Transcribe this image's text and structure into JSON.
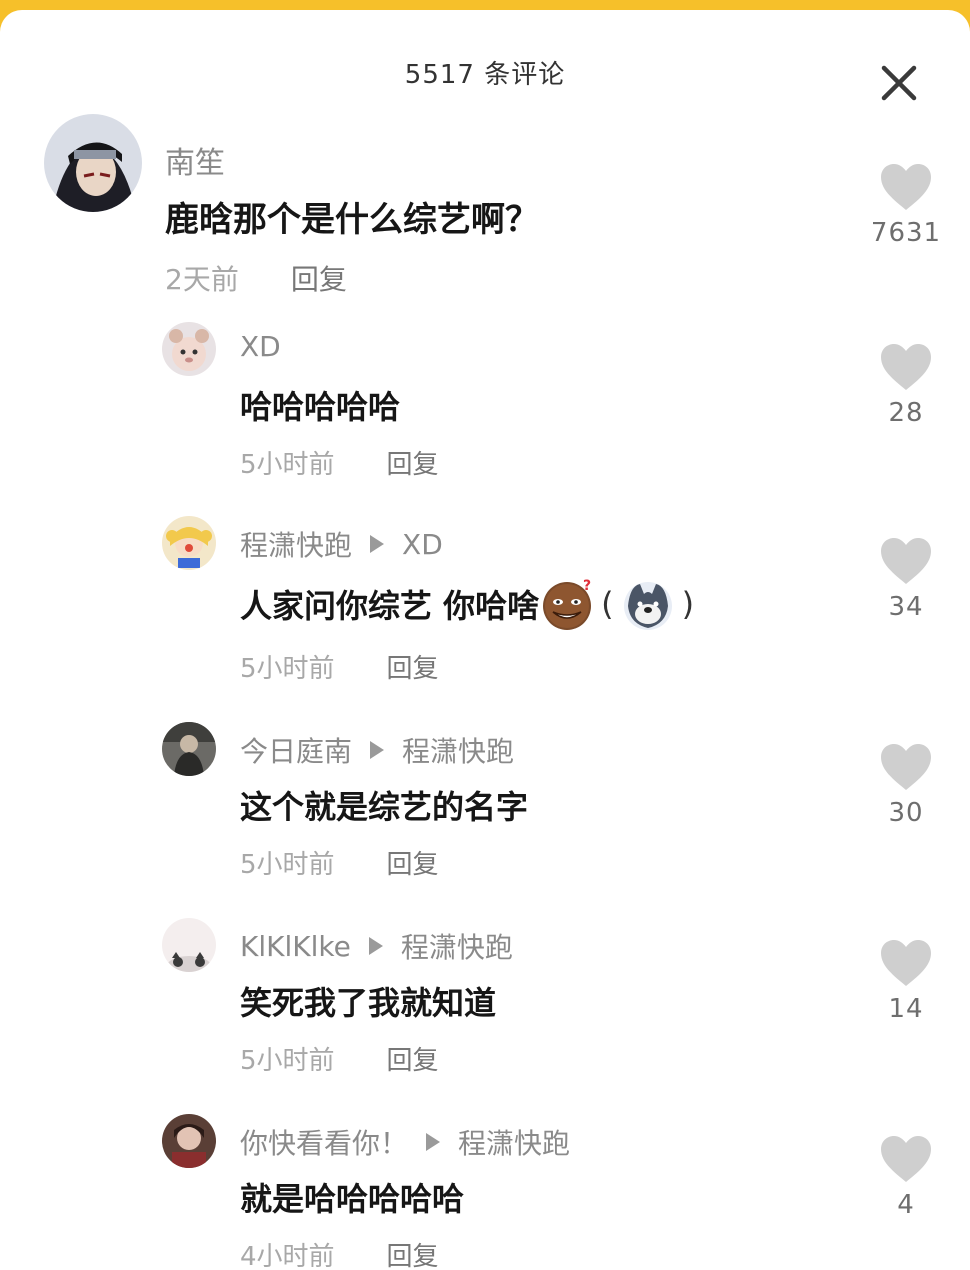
{
  "header": {
    "title": "5517 条评论"
  },
  "icons": {
    "close": "close-icon",
    "like": "heart-icon"
  },
  "colors": {
    "top_bar": "#f6c02a",
    "like_heart": "#cfcfcf"
  },
  "comments": [
    {
      "user": "南笙",
      "text": "鹿晗那个是什么综艺啊？",
      "time": "2天前",
      "reply_label": "回复",
      "likes": "7631"
    }
  ],
  "replies": [
    {
      "user": "XD",
      "reply_to": "",
      "text": "哈哈哈哈哈",
      "time": "5小时前",
      "reply_label": "回复",
      "likes": "28"
    },
    {
      "user": "程潇快跑",
      "reply_to": "XD",
      "text": "人家问你综艺  你哈啥",
      "paren_open": "(",
      "paren_close": ")",
      "time": "5小时前",
      "reply_label": "回复",
      "likes": "34"
    },
    {
      "user": "今日庭南",
      "reply_to": "程潇快跑",
      "text": "这个就是综艺的名字",
      "time": "5小时前",
      "reply_label": "回复",
      "likes": "30"
    },
    {
      "user": "KlKlKlke",
      "reply_to": "程潇快跑",
      "text": "笑死我了我就知道",
      "time": "5小时前",
      "reply_label": "回复",
      "likes": "14"
    },
    {
      "user": "你快看看你！",
      "reply_to": "程潇快跑",
      "text": "就是哈哈哈哈哈",
      "time": "4小时前",
      "reply_label": "回复",
      "likes": "4"
    }
  ]
}
